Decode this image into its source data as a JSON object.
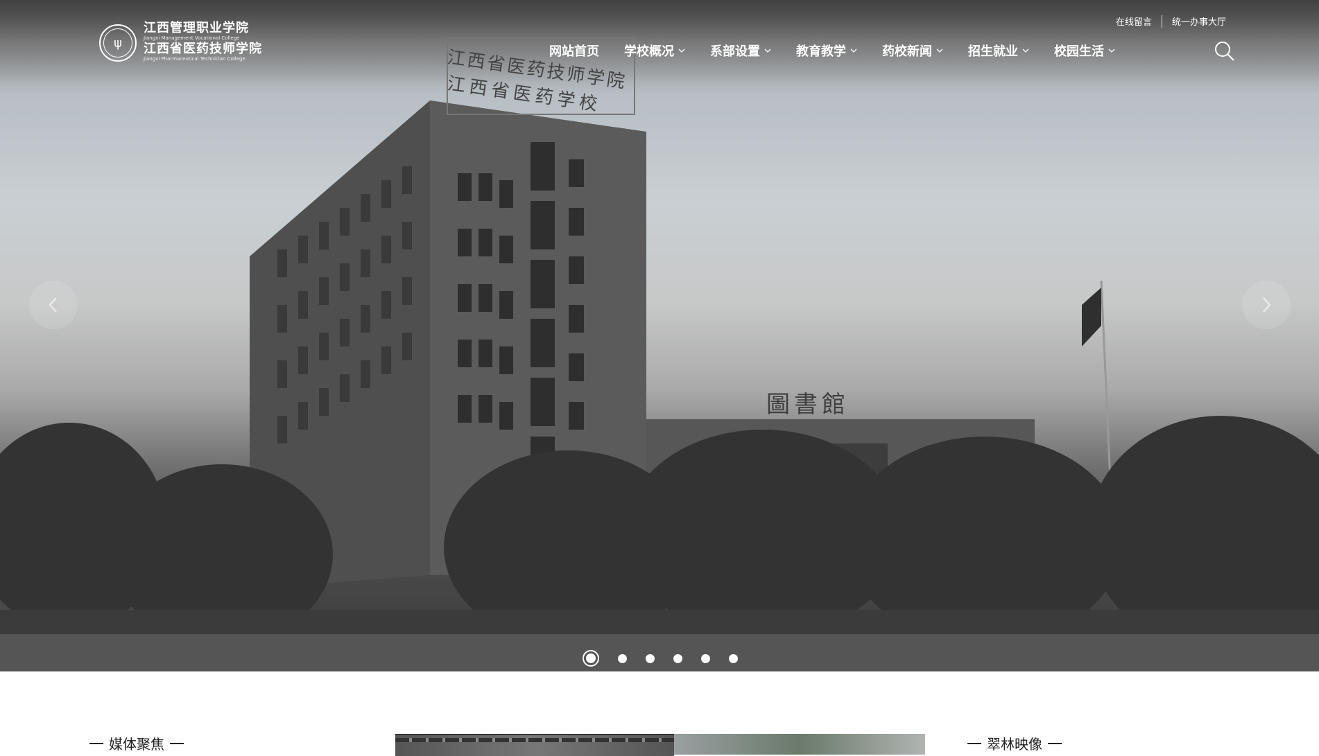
{
  "header": {
    "logo": {
      "cn_line1": "江西管理职业学院",
      "en_line1": "Jiangxi Management Vocational College",
      "cn_line2": "江西省医药技师学院",
      "en_line2": "Jiangxi Pharmaceutical Technician College",
      "icon": "school-emblem-icon"
    },
    "toplinks": [
      {
        "label": "在线留言"
      },
      {
        "label": "统一办事大厅"
      }
    ],
    "nav": [
      {
        "label": "网站首页",
        "has_dropdown": false
      },
      {
        "label": "学校概况",
        "has_dropdown": true
      },
      {
        "label": "系部设置",
        "has_dropdown": true
      },
      {
        "label": "教育教学",
        "has_dropdown": true
      },
      {
        "label": "药校新闻",
        "has_dropdown": true
      },
      {
        "label": "招生就业",
        "has_dropdown": true
      },
      {
        "label": "校园生活",
        "has_dropdown": true
      }
    ],
    "search_icon": "search-icon"
  },
  "hero": {
    "building_sign_1": "江西省医药技师学院",
    "building_sign_2": "江西省医药学校",
    "library_sign": "圖書館",
    "slide_count": 6,
    "active_slide": 1,
    "prev_icon": "chevron-left-icon",
    "next_icon": "chevron-right-icon"
  },
  "sections": {
    "left_title": "媒体聚焦",
    "right_title": "翠林映像"
  }
}
